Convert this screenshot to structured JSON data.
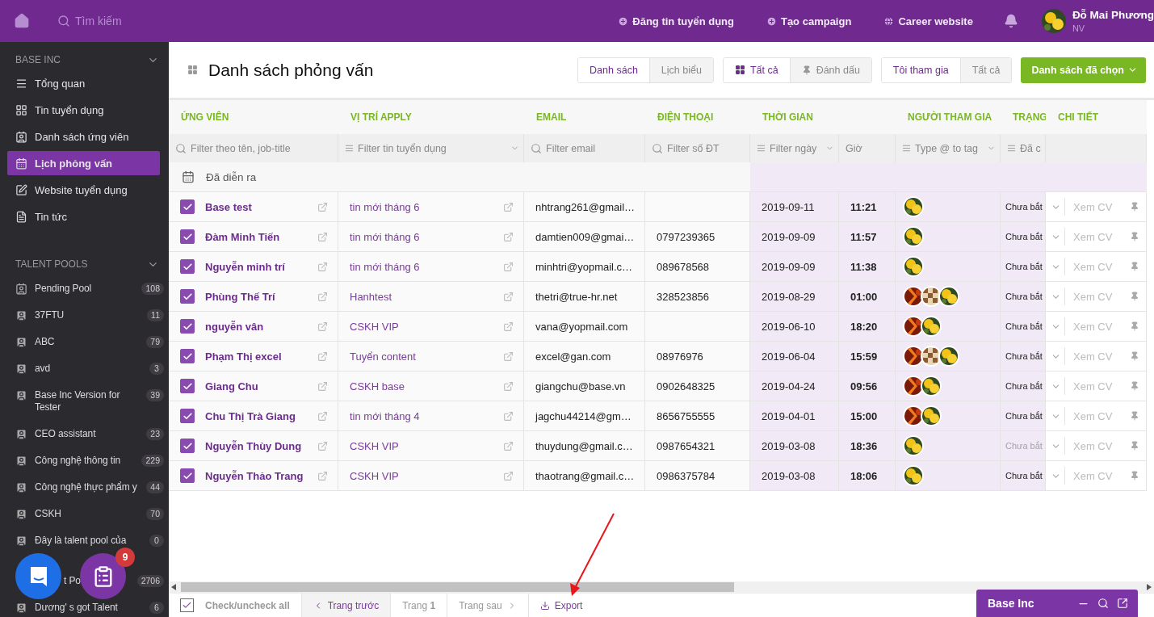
{
  "topbar": {
    "search": {
      "placeholder": "Tìm kiếm"
    },
    "links": [
      {
        "label": "Đăng tin tuyển dụng",
        "kind": "plus"
      },
      {
        "label": "Tạo campaign",
        "kind": "plus"
      },
      {
        "label": "Career website",
        "kind": "globe"
      }
    ],
    "user": {
      "name": "Đỗ Mai Phương",
      "role": "NV"
    }
  },
  "sidebar": {
    "company": {
      "title": "BASE INC",
      "items": [
        {
          "label": "Tổng quan",
          "kind": "menu",
          "selected": false
        },
        {
          "label": "Tin tuyển dụng",
          "kind": "grid",
          "selected": false
        },
        {
          "label": "Danh sách ứng viên",
          "kind": "contact",
          "selected": false
        },
        {
          "label": "Lịch phỏng vấn",
          "kind": "calendar",
          "selected": true
        },
        {
          "label": "Website tuyển dụng",
          "kind": "edit",
          "selected": false
        },
        {
          "label": "Tin tức",
          "kind": "news",
          "selected": false
        }
      ]
    },
    "talent_pools": {
      "title": "TALENT POOLS",
      "items": [
        {
          "name": "Pending Pool",
          "count": "108",
          "kind": "pending",
          "partial": false
        },
        {
          "name": "37FTU",
          "count": "11",
          "kind": "pool",
          "partial": false
        },
        {
          "name": "ABC",
          "count": "79",
          "kind": "pool",
          "partial": false
        },
        {
          "name": "avd",
          "count": "3",
          "kind": "pool",
          "partial": false
        },
        {
          "name": "Base Inc Version for Tester",
          "count": "39",
          "kind": "pool",
          "partial": false
        },
        {
          "name": "CEO assistant",
          "count": "23",
          "kind": "pool",
          "partial": false
        },
        {
          "name": "Công nghệ thông tin",
          "count": "229",
          "kind": "pool",
          "partial": false
        },
        {
          "name": "Công nghệ thực phẩm y",
          "count": "44",
          "kind": "pool",
          "partial": false
        },
        {
          "name": "CSKH",
          "count": "70",
          "kind": "pool",
          "partial": false
        },
        {
          "name": "Đây là talent pool của",
          "count": "0",
          "kind": "pool",
          "partial": false
        },
        {
          "name": "t Po",
          "count": "2706",
          "partial": true
        },
        {
          "name": "Dương' s got Talent",
          "count": "6",
          "kind": "pool",
          "partial": false
        }
      ]
    }
  },
  "page": {
    "title": "Danh sách phỏng vấn",
    "view_toggle": [
      {
        "label": "Danh sách",
        "selected": true
      },
      {
        "label": "Lịch biểu",
        "selected": false
      }
    ],
    "mark_toggle": [
      {
        "label": "Tất cả",
        "selected": true,
        "kind": "grid"
      },
      {
        "label": "Đánh dấu",
        "selected": false,
        "kind": "pin"
      }
    ],
    "participation_toggle": [
      {
        "label": "Tôi tham gia",
        "selected": true
      },
      {
        "label": "Tất cả",
        "selected": false
      }
    ],
    "primary_button": "Danh sách đã chọn"
  },
  "table": {
    "columns": [
      "ỨNG VIÊN",
      "VỊ TRÍ APPLY",
      "EMAIL",
      "ĐIỆN THOẠI",
      "THỜI GIAN",
      "",
      "NGƯỜI THAM GIA",
      "TRẠNG",
      "CHI TIẾT"
    ],
    "filters": [
      {
        "placeholder": "Filter theo tên, job-title",
        "kind": "search",
        "dropdown": false
      },
      {
        "placeholder": "Filter tin tuyển dụng",
        "kind": "list",
        "dropdown": true
      },
      {
        "placeholder": "Filter email",
        "kind": "search",
        "dropdown": false
      },
      {
        "placeholder": "Filter số ĐT",
        "kind": "search",
        "dropdown": false
      },
      {
        "placeholder": "Filter ngày",
        "kind": "list",
        "dropdown": true
      },
      {
        "placeholder": "Giờ",
        "kind": "plain",
        "dropdown": false
      },
      {
        "placeholder": "Type @ to tag",
        "kind": "list",
        "dropdown": true
      },
      {
        "placeholder": "Đã c",
        "kind": "list",
        "dropdown": false
      }
    ],
    "group": "Đã diễn ra",
    "rows": [
      {
        "checked": true,
        "name": "Base test",
        "position": "tin mới tháng 6",
        "email": "nhtrang261@gmail…",
        "phone": "",
        "date": "2019-09-11",
        "time": "11:21",
        "status": "Chưa bắt",
        "status_muted": false,
        "action": "Xem CV"
      },
      {
        "checked": true,
        "name": "Đàm Minh Tiến",
        "position": "tin mới tháng 6",
        "email": "damtien009@gmai…",
        "phone": "0797239365",
        "date": "2019-09-09",
        "time": "11:57",
        "status": "Chưa bắt",
        "status_muted": false,
        "action": "Xem CV"
      },
      {
        "checked": true,
        "name": "Nguyễn minh trí",
        "position": "tin mới tháng 6",
        "email": "minhtri@yopmail.c…",
        "phone": "089678568",
        "date": "2019-09-09",
        "time": "11:38",
        "status": "Chưa bắt",
        "status_muted": false,
        "action": "Xem CV"
      },
      {
        "checked": true,
        "name": "Phùng Thế Trí",
        "position": "Hanhtest",
        "email": "thetri@true-hr.net",
        "phone": "328523856",
        "date": "2019-08-29",
        "time": "01:00",
        "status": "Chưa bắt",
        "status_muted": false,
        "action": "Xem CV"
      },
      {
        "checked": true,
        "name": "nguyễn vân",
        "position": "CSKH VIP",
        "email": "vana@yopmail.com",
        "phone": "",
        "date": "2019-06-10",
        "time": "18:20",
        "status": "Chưa bắt",
        "status_muted": false,
        "action": "Xem CV"
      },
      {
        "checked": true,
        "name": "Phạm Thị excel",
        "position": "Tuyển content",
        "email": "excel@gan.com",
        "phone": "08976976",
        "date": "2019-06-04",
        "time": "15:59",
        "status": "Chưa bắt",
        "status_muted": false,
        "action": "Xem CV"
      },
      {
        "checked": true,
        "name": "Giang Chu",
        "position": "CSKH base",
        "email": "giangchu@base.vn",
        "phone": "0902648325",
        "date": "2019-04-24",
        "time": "09:56",
        "status": "Chưa bắt",
        "status_muted": false,
        "action": "Xem CV"
      },
      {
        "checked": true,
        "name": "Chu Thị Trà Giang",
        "position": "tin mới tháng 4",
        "email": "jagchu44214@gm…",
        "phone": "8656755555",
        "date": "2019-04-01",
        "time": "15:00",
        "status": "Chưa bắt",
        "status_muted": false,
        "action": "Xem CV"
      },
      {
        "checked": true,
        "name": "Nguyễn Thùy Dung",
        "position": "CSKH VIP",
        "email": "thuydung@gmail.c…",
        "phone": "0987654321",
        "date": "2019-03-08",
        "time": "18:36",
        "status": "Chưa bắt",
        "status_muted": true,
        "action": "Xem CV"
      },
      {
        "checked": true,
        "name": "Nguyễn Thảo Trang",
        "position": "CSKH VIP",
        "email": "thaotrang@gmail.c…",
        "phone": "0986375784",
        "date": "2019-03-08",
        "time": "18:06",
        "status": "Chưa bắt",
        "status_muted": false,
        "action": "Xem CV"
      }
    ]
  },
  "footer": {
    "check_all": {
      "label": "Check/uncheck all",
      "checked": true
    },
    "prev": "Trang trước",
    "page": "Trang **1**",
    "next": "Trang sau",
    "export": "Export"
  },
  "chat_panel": {
    "title": "Base Inc"
  },
  "floating": {
    "badge": "9"
  }
}
